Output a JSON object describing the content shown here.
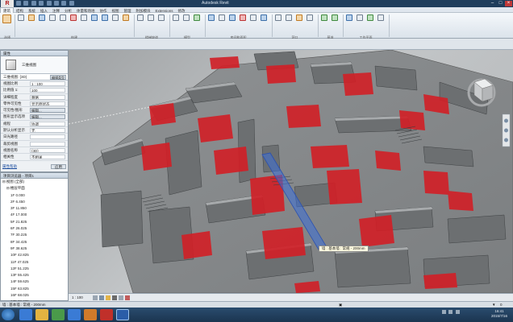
{
  "app": {
    "title": "Autodesk Revit",
    "window_controls": [
      "–",
      "□",
      "×"
    ]
  },
  "ribbon": {
    "tabs": [
      "建筑",
      "结构",
      "系统",
      "插入",
      "注释",
      "分析",
      "体量和场地",
      "协作",
      "视图",
      "管理",
      "附加模块",
      "Extensions",
      "修改"
    ],
    "active_tab_index": 0,
    "groups": [
      "选择",
      "构建",
      "楼梯坡道",
      "模型",
      "房间和面积",
      "洞口",
      "基准",
      "工作平面"
    ]
  },
  "properties": {
    "title": "属性",
    "type_name": "三维视图",
    "selector": "三维视图: {3D}",
    "edit_type_label": "编辑类型",
    "rows": [
      {
        "key": "视图比例",
        "value": "1 : 100",
        "button": false
      },
      {
        "key": "比例值 1:",
        "value": "100",
        "button": false
      },
      {
        "key": "详细程度",
        "value": "粗略",
        "button": false
      },
      {
        "key": "零件可见性",
        "value": "显示原状态",
        "button": false
      },
      {
        "key": "可见性/图形",
        "value": "编辑...",
        "button": true
      },
      {
        "key": "图形显示选项",
        "value": "编辑...",
        "button": true
      },
      {
        "key": "规程",
        "value": "协调",
        "button": false
      },
      {
        "key": "默认分析显示",
        "value": "无",
        "button": false
      },
      {
        "key": "日光路径",
        "value": "",
        "button": false
      },
      {
        "key": "裁剪视图",
        "value": "",
        "button": false
      },
      {
        "key": "视图名称",
        "value": "{3D}",
        "button": false
      },
      {
        "key": "相关性",
        "value": "不相关",
        "button": false
      }
    ],
    "help_link": "属性帮助",
    "apply_label": "应用"
  },
  "project_browser": {
    "title": "项目浏览器 - 项目1",
    "tree": [
      {
        "label": "视图 (全部)",
        "indent": 0,
        "toggle": "⊟"
      },
      {
        "label": "楼层平面",
        "indent": 1,
        "toggle": "⊟"
      },
      {
        "label": "1F 0.000",
        "indent": 2,
        "toggle": ""
      },
      {
        "label": "2F 6.450",
        "indent": 2,
        "toggle": ""
      },
      {
        "label": "3F 11.850",
        "indent": 2,
        "toggle": ""
      },
      {
        "label": "4F 17.000",
        "indent": 2,
        "toggle": ""
      },
      {
        "label": "5F 21.825",
        "indent": 2,
        "toggle": ""
      },
      {
        "label": "6F 26.025",
        "indent": 2,
        "toggle": ""
      },
      {
        "label": "7F 30.225",
        "indent": 2,
        "toggle": ""
      },
      {
        "label": "8F 34.425",
        "indent": 2,
        "toggle": ""
      },
      {
        "label": "9F 38.625",
        "indent": 2,
        "toggle": ""
      },
      {
        "label": "10F 42.825",
        "indent": 2,
        "toggle": ""
      },
      {
        "label": "11F 47.025",
        "indent": 2,
        "toggle": ""
      },
      {
        "label": "12F 51.225",
        "indent": 2,
        "toggle": ""
      },
      {
        "label": "13F 55.425",
        "indent": 2,
        "toggle": ""
      },
      {
        "label": "14F 59.625",
        "indent": 2,
        "toggle": ""
      },
      {
        "label": "15F 63.825",
        "indent": 2,
        "toggle": ""
      },
      {
        "label": "16F 68.025",
        "indent": 2,
        "toggle": ""
      },
      {
        "label": "17F 72.225",
        "indent": 2,
        "toggle": ""
      }
    ]
  },
  "viewport": {
    "view_name": "{3D}",
    "scale": "1 : 100",
    "tooltip": "墙 : 基本墙 : 常规 - 200mm"
  },
  "status": {
    "text": "墙 : 基本墙 : 常规 - 200mm",
    "selection_count": "0",
    "time": "16:41",
    "date": "2015/7/16"
  },
  "colors": {
    "accent": "#d21f26",
    "selection": "#3d6fd9",
    "taskbar": "#1f3d5c"
  }
}
